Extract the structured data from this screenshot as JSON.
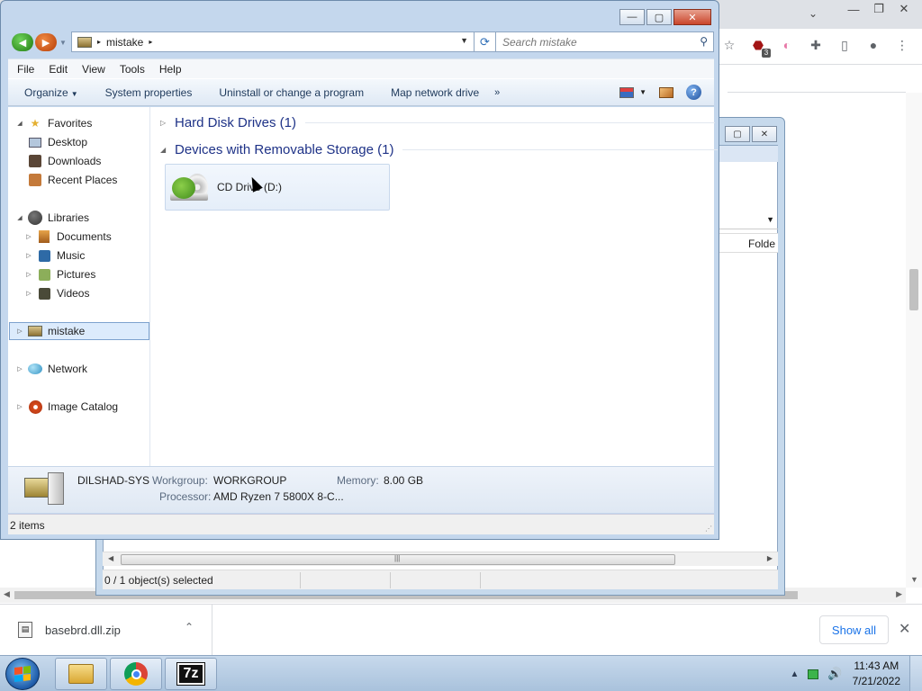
{
  "browser": {
    "tab_dropdown": "⌄",
    "window_buttons": [
      "—",
      "❐",
      "✕"
    ],
    "extension_badge": "3",
    "download": {
      "filename": "basebrd.dll.zip",
      "show_all": "Show all"
    }
  },
  "explorer_back": {
    "column_header": "Folde",
    "status": "0 / 1 object(s) selected"
  },
  "explorer": {
    "window_buttons": {
      "minimize": "—",
      "maximize": "▢",
      "close": "✕"
    },
    "address": {
      "crumbs": [
        "mistake"
      ],
      "separator": "▸"
    },
    "search": {
      "placeholder": "Search mistake"
    },
    "menu": [
      "File",
      "Edit",
      "View",
      "Tools",
      "Help"
    ],
    "commands": {
      "organize": "Organize",
      "system_properties": "System properties",
      "uninstall": "Uninstall or change a program",
      "map_drive": "Map network drive",
      "more": "»"
    },
    "nav": {
      "favorites": "Favorites",
      "desktop": "Desktop",
      "downloads": "Downloads",
      "recent": "Recent Places",
      "libraries": "Libraries",
      "documents": "Documents",
      "music": "Music",
      "pictures": "Pictures",
      "videos": "Videos",
      "computer": "mistake",
      "network": "Network",
      "image_catalog": "Image Catalog"
    },
    "groups": {
      "hdd": "Hard Disk Drives (1)",
      "removable": "Devices with Removable Storage (1)"
    },
    "drive": {
      "label": "CD Drive (D:)"
    },
    "details": {
      "computer_name": "DILSHAD-SYS",
      "workgroup_label": "Workgroup:",
      "workgroup_value": "WORKGROUP",
      "memory_label": "Memory:",
      "memory_value": "8.00 GB",
      "processor_label": "Processor:",
      "processor_value": "AMD Ryzen 7 5800X 8-C..."
    },
    "status": "2 items"
  },
  "taskbar": {
    "sevenzip_label": "7z",
    "time": "11:43 AM",
    "date": "7/21/2022"
  }
}
